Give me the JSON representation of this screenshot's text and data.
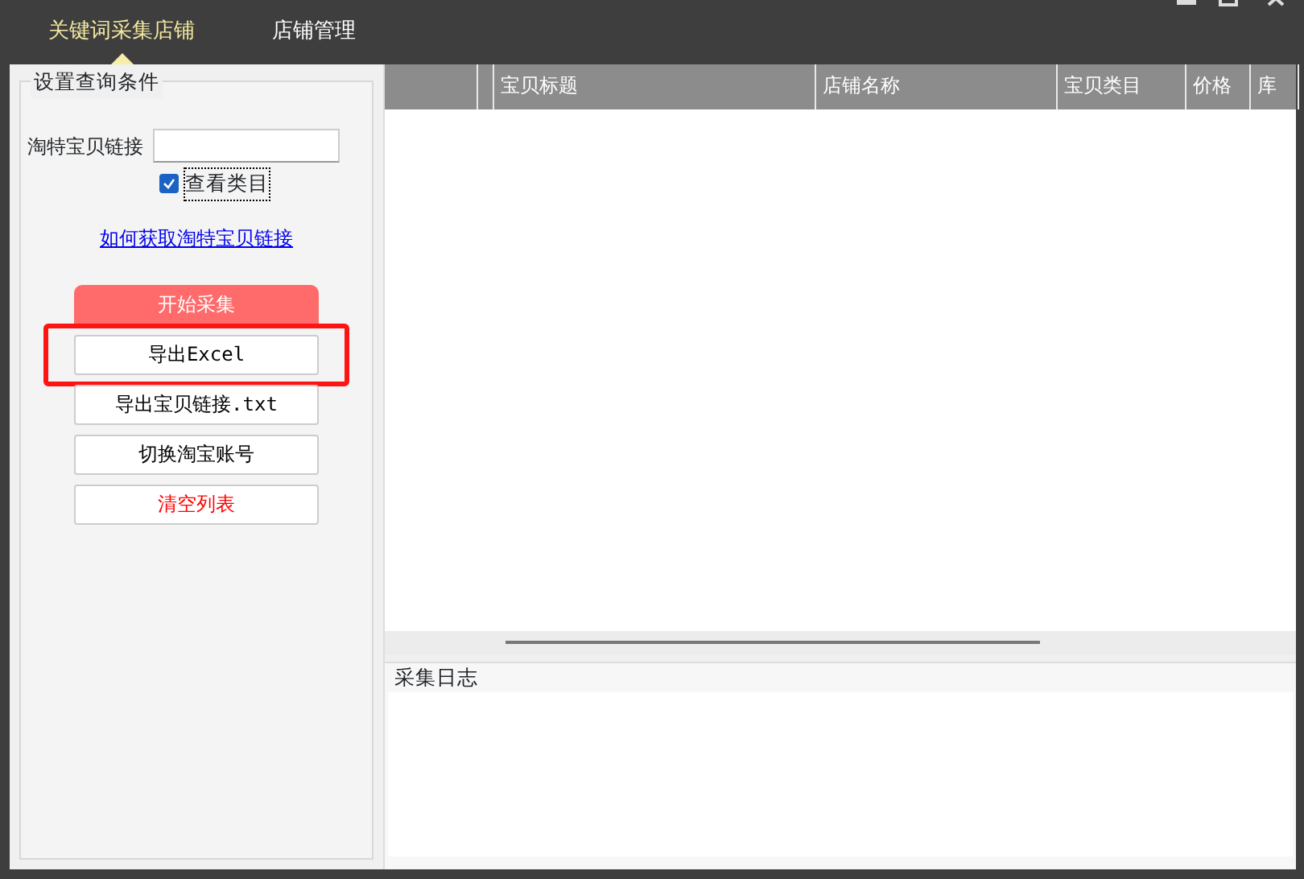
{
  "tabs": [
    {
      "label": "关键词采集店铺",
      "selected": true
    },
    {
      "label": "店铺管理",
      "selected": false
    }
  ],
  "query_group": {
    "title": "设置查询条件",
    "link_label": "淘特宝贝链接",
    "view_category": {
      "label": "查看类目",
      "checked": true
    },
    "help_link": "如何获取淘特宝贝链接",
    "buttons": [
      {
        "label": "开始采集",
        "kind": "primary",
        "highlighted": false
      },
      {
        "label": "导出Excel",
        "kind": "normal",
        "highlighted": true
      },
      {
        "label": "导出宝贝链接.txt",
        "kind": "normal",
        "highlighted": false
      },
      {
        "label": "切换淘宝账号",
        "kind": "normal",
        "highlighted": false
      },
      {
        "label": "清空列表",
        "kind": "danger",
        "highlighted": false
      }
    ]
  },
  "table": {
    "columns": [
      "",
      "",
      "宝贝标题",
      "店铺名称",
      "宝贝类目",
      "价格",
      "库"
    ]
  },
  "log": {
    "title": "采集日志"
  }
}
